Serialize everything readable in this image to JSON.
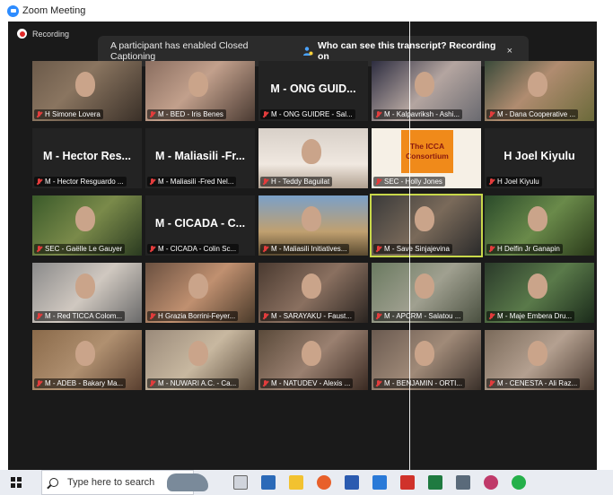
{
  "window": {
    "title": "Zoom Meeting"
  },
  "recording": {
    "label": "Recording"
  },
  "banner": {
    "message": "A participant has enabled Closed Captioning",
    "who_link": "Who can see this transcript? Recording on",
    "close": "×"
  },
  "participants": [
    {
      "label": "H Simone Lovera",
      "tile_text": "",
      "style": "v1"
    },
    {
      "label": "M - BED - Iris Benes",
      "tile_text": "",
      "style": "v2"
    },
    {
      "label": "M - ONG GUIDRE - Sal...",
      "tile_text": "M - ONG GUID...",
      "style": ""
    },
    {
      "label": "M - Kalpavriksh - Ashi...",
      "tile_text": "",
      "style": "v3"
    },
    {
      "label": "M - Dana Cooperative ...",
      "tile_text": "",
      "style": "v4"
    },
    {
      "label": "M - Hector Resguardo ...",
      "tile_text": "M - Hector Res...",
      "style": ""
    },
    {
      "label": "M - Maliasili -Fred Nel...",
      "tile_text": "M - Maliasili -Fr...",
      "style": ""
    },
    {
      "label": "H - Teddy Baguilat",
      "tile_text": "",
      "style": "v5"
    },
    {
      "label": "SEC - Holly Jones",
      "tile_text": "",
      "style": "v6"
    },
    {
      "label": "H Joel Kiyulu",
      "tile_text": "H Joel Kiyulu",
      "style": ""
    },
    {
      "label": "SEC - Gaëlle Le Gauyer",
      "tile_text": "",
      "style": "v7"
    },
    {
      "label": "M - CICADA - Colin Sc...",
      "tile_text": "M - CICADA - C...",
      "style": ""
    },
    {
      "label": "M - Maliasili Initiatives...",
      "tile_text": "",
      "style": "v8"
    },
    {
      "label": "M - Save Sinjajevina",
      "tile_text": "",
      "style": "v9"
    },
    {
      "label": "H Delfin Jr Ganapin",
      "tile_text": "",
      "style": "v10"
    },
    {
      "label": "M - Red TICCA Colom...",
      "tile_text": "",
      "style": "v11"
    },
    {
      "label": "H Grazia Borrini-Feyer...",
      "tile_text": "",
      "style": "v12"
    },
    {
      "label": "M - SARAYAKU - Faust...",
      "tile_text": "",
      "style": "v13"
    },
    {
      "label": "M - APCRM - Salatou ...",
      "tile_text": "",
      "style": "v14"
    },
    {
      "label": "M - Maje Embera Dru...",
      "tile_text": "",
      "style": "v15"
    },
    {
      "label": "M - ADEB - Bakary Ma...",
      "tile_text": "",
      "style": "v16"
    },
    {
      "label": "M - NUWARI A.C. - Ca...",
      "tile_text": "",
      "style": "v17"
    },
    {
      "label": "M - NATUDEV - Alexis ...",
      "tile_text": "",
      "style": "v18"
    },
    {
      "label": "M - BENJAMIN - ORTI...",
      "tile_text": "",
      "style": "v19"
    },
    {
      "label": "M - CENESTA - Ali Raz...",
      "tile_text": "",
      "style": "v20"
    }
  ],
  "icca_card": {
    "line1": "The ICCA",
    "line2": "Consortium"
  },
  "taskbar": {
    "search_placeholder": "Type here to search"
  },
  "colors": {
    "stage_bg": "#1a1a1a",
    "highlight": "#c8d84a",
    "zoom_blue": "#2d8cff",
    "muted_red": "#e23c3c"
  }
}
